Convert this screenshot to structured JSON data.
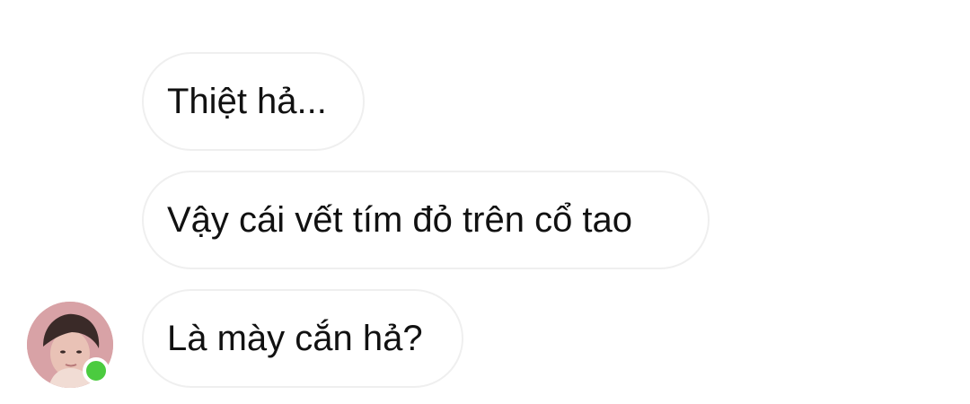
{
  "messages": [
    {
      "text": "Thiệt hả..."
    },
    {
      "text": "Vậy cái vết tím đỏ trên cổ tao"
    },
    {
      "text": "Là mày cắn hả?"
    }
  ],
  "sender": {
    "avatar_icon": "profile-photo",
    "online": true,
    "status_color": "#4bcb3f"
  },
  "colors": {
    "bubble_border": "#efefef",
    "text": "#111111",
    "background": "#ffffff"
  }
}
